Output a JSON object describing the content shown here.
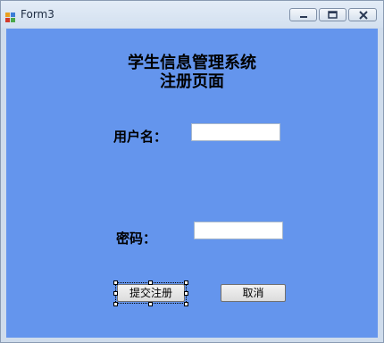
{
  "window": {
    "title": "Form3",
    "icons": {
      "app": "form-app-icon",
      "minimize": "minimize-icon",
      "maximize": "maximize-icon",
      "close": "close-icon"
    }
  },
  "form": {
    "heading_line1": "学生信息管理系统",
    "heading_line2": "注册页面",
    "username_label": "用户名：",
    "username_value": "",
    "password_label": "密码：",
    "password_value": "",
    "submit_label": "提交注册",
    "cancel_label": "取消"
  },
  "colors": {
    "client_background": "#6495ed",
    "titlebar": "#d3e0ef"
  }
}
